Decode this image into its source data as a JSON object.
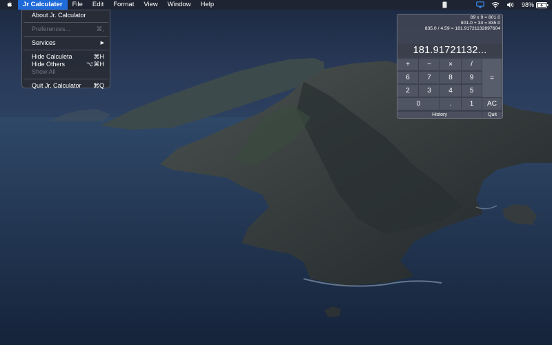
{
  "menubar": {
    "app_name": "Jr Calculater",
    "menus": [
      "File",
      "Edit",
      "Format",
      "View",
      "Window",
      "Help"
    ],
    "battery_percent": "98%"
  },
  "dropdown": {
    "about": "About Jr. Calculator",
    "preferences": "Preferences...",
    "preferences_shortcut": "⌘,",
    "services": "Services",
    "services_arrow": "▶",
    "hide_app": "Hide Calculeta",
    "hide_app_shortcut": "⌘H",
    "hide_others": "Hide Others",
    "hide_others_shortcut": "⌥⌘H",
    "show_all": "Show All",
    "quit": "Quit Jr. Calculator",
    "quit_shortcut": "⌘Q"
  },
  "calculator": {
    "history": [
      "89 x 9 = 801.0",
      "801.0 + 34 = 835.0",
      "835.0 / 4.59 = 181.91721132897604"
    ],
    "display": "181.91721132...",
    "keys": {
      "plus": "+",
      "minus": "−",
      "times": "×",
      "divide": "/",
      "equals": "=",
      "seven_label": "6",
      "n7": "7",
      "n8": "8",
      "n9": "9",
      "n2": "2",
      "n3": "3",
      "n4": "4",
      "n5": "5",
      "n0": "0",
      "dot": ".",
      "n1": "1",
      "clear": "AC"
    },
    "history_button": "History",
    "quit_button": "Quit"
  },
  "colors": {
    "menu_highlight": "#1f6ad9",
    "panel_bg": "#3e4452"
  }
}
